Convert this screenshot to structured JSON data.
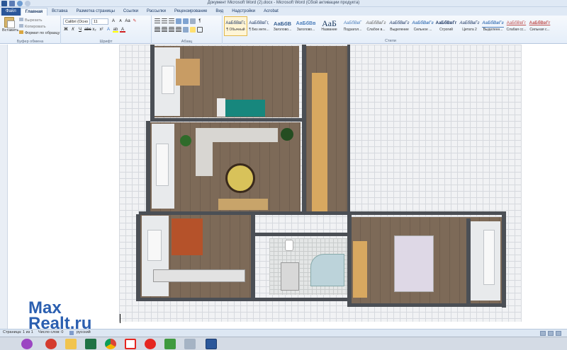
{
  "window": {
    "title": "Документ Microsoft Word (2).docx  -  Microsoft Word (Сбой активации продукта)"
  },
  "tabs": [
    {
      "label": "Файл"
    },
    {
      "label": "Главная"
    },
    {
      "label": "Вставка"
    },
    {
      "label": "Разметка страницы"
    },
    {
      "label": "Ссылки"
    },
    {
      "label": "Рассылки"
    },
    {
      "label": "Рецензирование"
    },
    {
      "label": "Вид"
    },
    {
      "label": "Надстройки"
    },
    {
      "label": "Acrobat"
    }
  ],
  "clipboard": {
    "paste_label": "Вставить",
    "cut_label": "Вырезать",
    "copy_label": "Копировать",
    "format_painter_label": "Формат по образцу",
    "group_label": "Буфер обмена"
  },
  "font": {
    "family_value": "Calibri (Осно",
    "size_value": "11",
    "group_label": "Шрифт"
  },
  "paragraph": {
    "group_label": "Абзац"
  },
  "styles": {
    "group_label": "Стили",
    "items": [
      {
        "sample": "АаБбВвГг,",
        "name": "¶ Обычный"
      },
      {
        "sample": "АаБбВвГг,",
        "name": "¶ Без инте..."
      },
      {
        "sample": "АаБбВ",
        "name": "Заголово..."
      },
      {
        "sample": "АаБбВв",
        "name": "Заголово..."
      },
      {
        "sample": "АаБ",
        "name": "Название"
      },
      {
        "sample": "АаБбВвГ",
        "name": "Подзагол..."
      },
      {
        "sample": "АаБбВвГг",
        "name": "Слабое в..."
      },
      {
        "sample": "АаБбВвГг",
        "name": "Выделение"
      },
      {
        "sample": "АаБбВвГг",
        "name": "Сильное ..."
      },
      {
        "sample": "АаБбВвГг",
        "name": "Строгий"
      },
      {
        "sample": "АаБбВвГг",
        "name": "Цитата 2"
      },
      {
        "sample": "АаБбВвГг",
        "name": "Выделенн..."
      },
      {
        "sample": "АаБбВвГг",
        "name": "Слабая сс..."
      },
      {
        "sample": "АаБбВвГг",
        "name": "Сильная с..."
      }
    ]
  },
  "watermark": {
    "line1": "Max",
    "line2": "Realt.ru"
  },
  "status": {
    "page": "Страница: 1 из 1",
    "words": "Число слов: 0",
    "language": "русский"
  },
  "taskbar": {
    "apps": [
      "browser-icon",
      "opera-icon",
      "file-explorer-icon",
      "excel-icon",
      "chrome-icon",
      "yandex-icon",
      "yandex-browser-icon",
      "shield-icon",
      "tools-icon",
      "word-icon"
    ]
  },
  "colors": {
    "accent": "#2b579a",
    "watermark": "#2b5fb0"
  }
}
